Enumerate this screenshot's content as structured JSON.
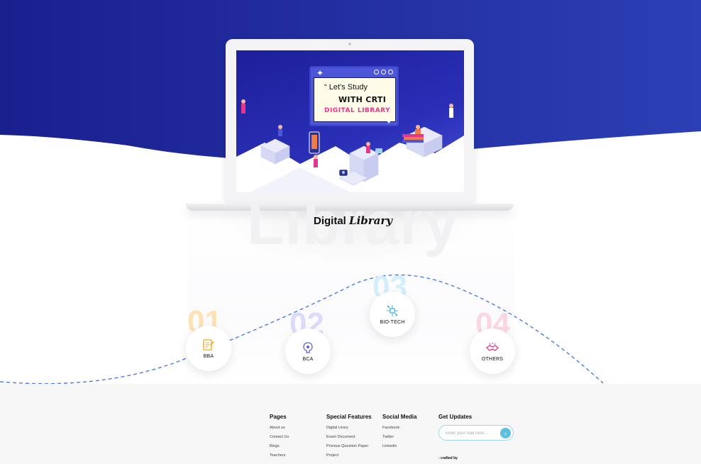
{
  "colors": {
    "hero_start": "#1a1f8e",
    "hero_end": "#2c3fb5",
    "accent_pink": "#e6358a",
    "accent_blue": "#5bbfe0",
    "num_01": "#fde3b3",
    "num_02": "#dcdcf8",
    "num_03": "#d5effa",
    "num_04": "#fbd7e3",
    "wave": "#4a7bdc"
  },
  "screen": {
    "line1": "“ Let’s Study",
    "line2": "WITH CRTI",
    "line3": "DIGITAL LIBRARY"
  },
  "section": {
    "watermark": "Library",
    "title_plain": "Digital",
    "title_italic": "Library"
  },
  "categories": [
    {
      "num": "01",
      "label": "BBA",
      "icon": "certificate-icon"
    },
    {
      "num": "02",
      "label": "BCA",
      "icon": "brain-chip-icon"
    },
    {
      "num": "03",
      "label": "BIO-TECH",
      "icon": "circuit-icon"
    },
    {
      "num": "04",
      "label": "OTHERS",
      "icon": "handshake-icon"
    }
  ],
  "footer": {
    "pages": {
      "heading": "Pages",
      "links": [
        "About us",
        "Contact Us",
        "Blogs",
        "Teachers"
      ]
    },
    "features": {
      "heading": "Special Features",
      "links": [
        "Digital Lirary",
        "Exam Document",
        "Privious Question Paper",
        "Project"
      ]
    },
    "social": {
      "heading": "Social Media",
      "links": [
        "Facebook",
        "Twitter",
        "Linkedin"
      ]
    },
    "updates": {
      "heading": "Get Updates",
      "placeholder": "Enter your mail here...",
      "button": "›"
    },
    "crafted": "- crafted by"
  }
}
